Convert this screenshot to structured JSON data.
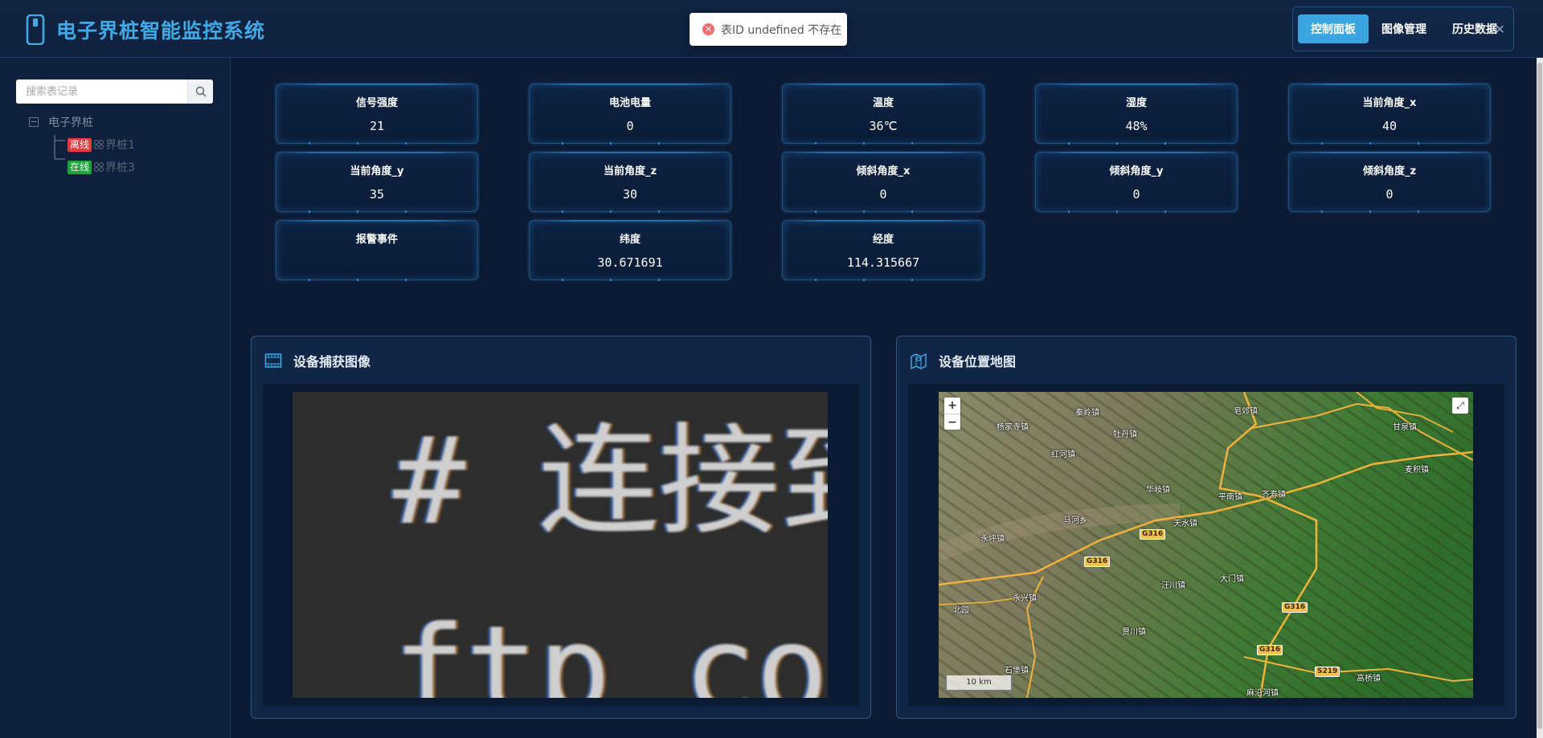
{
  "app": {
    "title": "电子界桩智能监控系统"
  },
  "toast": {
    "message": "表ID undefined 不存在",
    "icon": "error-circle-icon"
  },
  "nav": {
    "items": [
      {
        "label": "控制面板",
        "active": true
      },
      {
        "label": "图像管理",
        "active": false
      },
      {
        "label": "历史数据",
        "active": false
      }
    ],
    "close_icon": "close-icon"
  },
  "sidebar": {
    "search_placeholder": "搜索表记录",
    "tree": {
      "root_label": "电子界桩",
      "children": [
        {
          "status": "离线",
          "label": "界桩1",
          "status_color": "#e23c3c"
        },
        {
          "status": "在线",
          "label": "界桩3",
          "status_color": "#1aa53a"
        }
      ]
    }
  },
  "metrics": [
    {
      "label": "信号强度",
      "value": "21"
    },
    {
      "label": "电池电量",
      "value": "0"
    },
    {
      "label": "温度",
      "value": "36℃"
    },
    {
      "label": "湿度",
      "value": "48%"
    },
    {
      "label": "当前角度_x",
      "value": "40"
    },
    {
      "label": "当前角度_y",
      "value": "35"
    },
    {
      "label": "当前角度_z",
      "value": "30"
    },
    {
      "label": "倾斜角度_x",
      "value": "0"
    },
    {
      "label": "倾斜角度_y",
      "value": "0"
    },
    {
      "label": "倾斜角度_z",
      "value": "0"
    },
    {
      "label": "报警事件",
      "value": ""
    },
    {
      "label": "纬度",
      "value": "30.671691"
    },
    {
      "label": "经度",
      "value": "114.315667"
    }
  ],
  "capture_panel": {
    "title": "设备捕获图像",
    "image_text": {
      "line1": "# 连接到",
      "line2": "ftp con"
    }
  },
  "map_panel": {
    "title": "设备位置地图",
    "zoom_in": "+",
    "zoom_out": "−",
    "fullscreen": "⤢",
    "scale": "10 km",
    "labels": [
      "秦岭镇",
      "杨家寺镇",
      "牡丹镇",
      "皂郊镇",
      "甘泉镇",
      "红河镇",
      "麦积镇",
      "华岐镇",
      "平南镇",
      "齐寿镇",
      "天水镇",
      "马河乡",
      "永坪镇",
      "大门镇",
      "汪川镇",
      "永兴镇",
      "北园",
      "贾川镇",
      "石堡镇",
      "麻沿河镇",
      "高桥镇"
    ],
    "road_shields": [
      "G316",
      "G316",
      "G316",
      "G316",
      "S219"
    ]
  },
  "colors": {
    "accent": "#3aa5e0",
    "background": "#0c1a33",
    "card_border": "#1f4f7d"
  }
}
